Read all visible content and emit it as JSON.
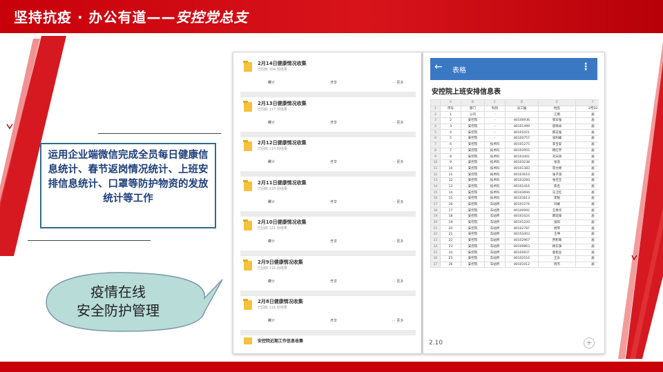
{
  "header": {
    "title_plain": "坚持抗疫 · 办公有道——",
    "title_italic": "安控党总支"
  },
  "info_box": {
    "text": "运用企业端微信完成全员每日健康信息统计、春节返岗情况统计、上班安排信息统计、口罩等防护物资的发放统计等工作"
  },
  "bubble": {
    "line1": "疫情在线",
    "line2": "安全防护管理"
  },
  "left_phone": {
    "records": [
      {
        "title": "2月14日健康情况收集",
        "sub": "已回收 104 份结果"
      },
      {
        "title": "2月13日健康情况收集",
        "sub": "已回收 117 份结果"
      },
      {
        "title": "2月12日健康情况收集",
        "sub": "已回收 114 份结果"
      },
      {
        "title": "2月11日健康情况收集",
        "sub": "已回收 118 份结果"
      },
      {
        "title": "2月10日健康情况收集",
        "sub": "已回收 121 份结果"
      },
      {
        "title": "2月9日健康情况收集",
        "sub": "已回收 116 份结果"
      },
      {
        "title": "2月8日健康情况收集",
        "sub": "已回收 116 份结果"
      }
    ],
    "action_stats": "统计",
    "action_share": "分享",
    "action_more": "··· 更多",
    "last_title": "安控院近期工作信息收集"
  },
  "right_phone": {
    "app_title": "表格",
    "back_icon": "arrow-left-icon",
    "more_icon": "vertical-dots-icon",
    "sheet_title": "安控院上班安排信息表",
    "col_letters": [
      "",
      "A",
      "B",
      "C",
      "D",
      "E",
      "F"
    ],
    "col_headers": [
      "1",
      "序号",
      "部门",
      "科别",
      "员工编",
      "姓名",
      "2月10"
    ],
    "rows": [
      [
        "2",
        "1",
        "公司",
        "-",
        "",
        "江明",
        "居"
      ],
      [
        "3",
        "2",
        "安控院",
        "-",
        "80100936",
        "郭军强",
        "居"
      ],
      [
        "4",
        "3",
        "安控院",
        "-",
        "80101499",
        "崔晓卓",
        "居"
      ],
      [
        "5",
        "4",
        "安控院",
        "-",
        "80101021",
        "邢志强",
        "居"
      ],
      [
        "6",
        "5",
        "安控院",
        "-",
        "80100757",
        "张利峰",
        "居"
      ],
      [
        "7",
        "6",
        "安控院",
        "技术科",
        "80101275",
        "李宝安",
        "居"
      ],
      [
        "8",
        "7",
        "安控院",
        "技术科",
        "80102955",
        "韩红宇",
        "居"
      ],
      [
        "9",
        "8",
        "安控院",
        "技术科",
        "80103402",
        "刘天琦",
        "居"
      ],
      [
        "10",
        "9",
        "安控院",
        "技术科",
        "80103238",
        "张浩",
        "居"
      ],
      [
        "11",
        "10",
        "安控院",
        "技术科",
        "80101383",
        "李文婷",
        "居"
      ],
      [
        "12",
        "11",
        "安控院",
        "技术科",
        "80103610",
        "张子琪",
        "居"
      ],
      [
        "13",
        "12",
        "安控院",
        "技术科",
        "80103260",
        "张佳玉",
        "居"
      ],
      [
        "14",
        "13",
        "安控院",
        "技术科",
        "80101416",
        "焦名",
        "居"
      ],
      [
        "15",
        "14",
        "安控院",
        "技术科",
        "80103694",
        "马卫红",
        "居"
      ],
      [
        "16",
        "15",
        "安控院",
        "技术科",
        "80103613",
        "李锐",
        "居"
      ],
      [
        "17",
        "16",
        "安控院",
        "车站所",
        "80101274",
        "刘峰",
        "居"
      ],
      [
        "18",
        "17",
        "安控院",
        "车站所",
        "80100992",
        "王春华",
        "居"
      ],
      [
        "19",
        "18",
        "安控院",
        "车站所",
        "80101024",
        "郝延锋",
        "居"
      ],
      [
        "20",
        "19",
        "安控院",
        "车站所",
        "80101220",
        "张阳",
        "居"
      ],
      [
        "21",
        "20",
        "安控院",
        "车站所",
        "80102787",
        "杨琴",
        "居"
      ],
      [
        "22",
        "21",
        "安控院",
        "车站所",
        "80103403",
        "王坤",
        "居"
      ],
      [
        "23",
        "22",
        "安控院",
        "车站所",
        "80102967",
        "贾积禹",
        "居"
      ],
      [
        "24",
        "23",
        "安控院",
        "车站所",
        "80100863",
        "顾东旗",
        "居"
      ],
      [
        "25",
        "24",
        "安控院",
        "车站所",
        "80100937",
        "金松岳",
        "居"
      ],
      [
        "26",
        "25",
        "安控院",
        "车站所",
        "80102516",
        "王东",
        "居"
      ],
      [
        "27",
        "26",
        "安控院",
        "车站所",
        "80101012",
        "周杰",
        "居"
      ]
    ],
    "footer_label": "2.10",
    "plus_icon": "plus-icon"
  }
}
